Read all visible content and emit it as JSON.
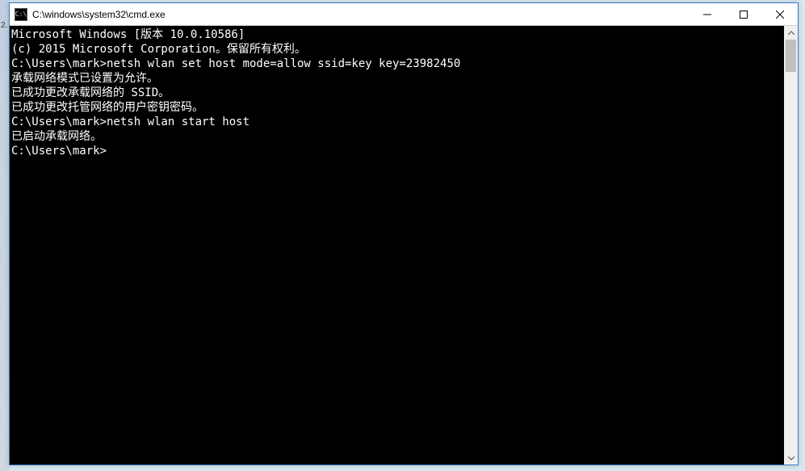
{
  "window": {
    "title": "C:\\windows\\system32\\cmd.exe",
    "icon_label": "C:\\"
  },
  "terminal": {
    "lines": [
      "Microsoft Windows [版本 10.0.10586]",
      "(c) 2015 Microsoft Corporation。保留所有权利。",
      "",
      "C:\\Users\\mark>netsh wlan set host mode=allow ssid=key key=23982450",
      "承载网络模式已设置为允许。",
      "已成功更改承载网络的 SSID。",
      "已成功更改托管网络的用户密钥密码。",
      "",
      "",
      "C:\\Users\\mark>netsh wlan start host",
      "已启动承载网络。",
      "",
      "",
      "C:\\Users\\mark>"
    ]
  }
}
